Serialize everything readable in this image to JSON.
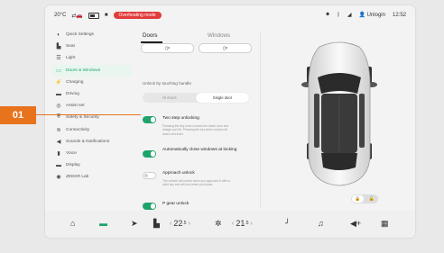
{
  "status": {
    "temp": "20°C",
    "alert": "Overheating mode",
    "user": "Unlogin",
    "time": "12:52"
  },
  "sidebar": {
    "items": [
      {
        "label": "Quick Settings",
        "icon": "toggle-icon"
      },
      {
        "label": "Seat",
        "icon": "seat-icon"
      },
      {
        "label": "Light",
        "icon": "light-icon"
      },
      {
        "label": "Doors & Windows",
        "icon": "door-icon",
        "active": true
      },
      {
        "label": "Charging",
        "icon": "charging-icon"
      },
      {
        "label": "Driving",
        "icon": "steering-icon"
      },
      {
        "label": "Assist set",
        "icon": "assist-icon"
      },
      {
        "label": "Safety & Security",
        "icon": "shield-icon"
      },
      {
        "label": "Connectivity",
        "icon": "wifi-icon"
      },
      {
        "label": "Sounds & Notifications",
        "icon": "sound-icon"
      },
      {
        "label": "Voice",
        "icon": "voice-icon"
      },
      {
        "label": "Display",
        "icon": "display-icon"
      },
      {
        "label": "ZEEKR Lab",
        "icon": "lab-icon"
      }
    ]
  },
  "tabs": [
    "Doors",
    "Windows"
  ],
  "doors": {
    "unlock_title": "Unlock by touching handle",
    "unlock_options": [
      "All doors",
      "Single door"
    ],
    "two_step": {
      "title": "Two step unlocking",
      "desc": "Pressing the key once unlocks the driver door and charge port lid. Pressing the key twice unlocks all doors and trunk."
    },
    "auto_close": {
      "title": "Automatically close windows at locking"
    },
    "approach": {
      "title": "Approach unlock",
      "desc": "The vehicle will unlock when you approach it with a valid key and will lock when you leave."
    },
    "pgear": {
      "title": "P gear unlock"
    }
  },
  "bottom": {
    "temp_left": "22",
    "temp_left_dec": ".5",
    "temp_right": "21",
    "temp_right_dec": ".5"
  },
  "callout": "01",
  "colors": {
    "accent": "#1fa36b",
    "callout": "#e8731d",
    "alert": "#e23b3b"
  }
}
